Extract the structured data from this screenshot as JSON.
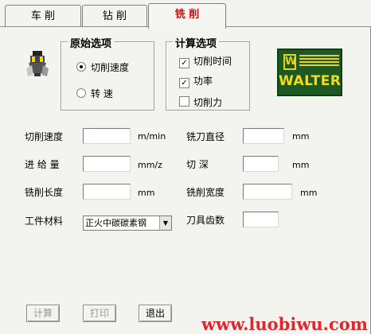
{
  "tabs": [
    {
      "label": "车  削",
      "active": false
    },
    {
      "label": "钻  削",
      "active": false
    },
    {
      "label": "铣  削",
      "active": true
    }
  ],
  "original_options": {
    "title": "原始选项",
    "radios": [
      {
        "label": "切削速度",
        "selected": true
      },
      {
        "label": "转      速",
        "selected": false
      }
    ]
  },
  "calc_options": {
    "title": "计算选项",
    "checks": [
      {
        "label": "切削时间",
        "checked": true
      },
      {
        "label": "功率",
        "checked": true
      },
      {
        "label": "切削力",
        "checked": false
      }
    ]
  },
  "logo": {
    "text": "WALTER",
    "colors": {
      "background": "#1d5a23",
      "foreground": "#e8d21a"
    }
  },
  "fields": {
    "cutting_speed": {
      "label": "切削速度",
      "unit": "m/min",
      "value": ""
    },
    "feed": {
      "label": "进 给 量",
      "unit": "mm/z",
      "value": ""
    },
    "milling_length": {
      "label": "铣削长度",
      "unit": "mm",
      "value": ""
    },
    "cutter_diameter": {
      "label": "铣刀直径",
      "unit": "mm",
      "value": ""
    },
    "depth": {
      "label": "切      深",
      "unit": "mm",
      "value": ""
    },
    "milling_width": {
      "label": "铣削宽度",
      "unit": "mm",
      "value": ""
    },
    "material": {
      "label": "工件材料",
      "selected": "正火中碳碳素钢"
    },
    "teeth": {
      "label": "刀具齿数",
      "value": ""
    }
  },
  "buttons": {
    "calculate": "计算",
    "print": "打印",
    "exit": "退出"
  },
  "watermark": "www.luobiwu.com"
}
